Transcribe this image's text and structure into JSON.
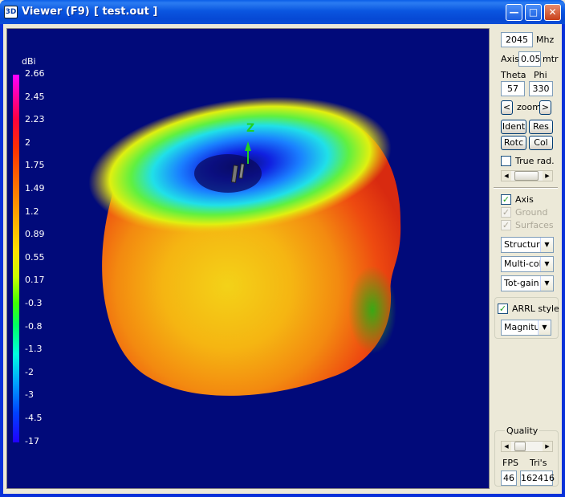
{
  "window": {
    "icon_text": "3D",
    "title": "Viewer (F9)",
    "file": "[  test.out ]",
    "min_glyph": "—",
    "max_glyph": "□",
    "close_glyph": "✕"
  },
  "legend": {
    "unit": "dBi",
    "labels": [
      "2.66",
      "2.45",
      "2.23",
      "2",
      "1.75",
      "1.49",
      "1.2",
      "0.89",
      "0.55",
      "0.17",
      "-0.3",
      "-0.8",
      "-1.3",
      "-2",
      "-3",
      "-4.5",
      "-17"
    ]
  },
  "scene": {
    "axis_label": "Z",
    "background": "#010a7a"
  },
  "controls": {
    "freq_value": "2045",
    "freq_unit": "Mhz",
    "axis_label": "Axis",
    "axis_value": "0.05",
    "axis_unit": "mtr",
    "theta_label": "Theta",
    "phi_label": "Phi",
    "theta_value": "57",
    "phi_value": "330",
    "zoom_left": "<",
    "zoom_label": "zoom",
    "zoom_right": ">",
    "ident_label": "Ident",
    "res_label": "Res",
    "rotc_label": "Rotc",
    "col_label": "Col",
    "true_rad_label": "True rad.",
    "axis_check_label": "Axis",
    "ground_check_label": "Ground",
    "surfaces_check_label": "Surfaces",
    "structure_value": "Structure",
    "color_value": "Multi-colo",
    "gain_value": "Tot-gain",
    "arrl_label": "ARRL style",
    "magnitude_value": "Magnitud",
    "quality_label": "Quality",
    "fps_label": "FPS",
    "tris_label": "Tri's",
    "fps_value": "46",
    "tris_value": "162416"
  },
  "checkboxes": {
    "true_rad": false,
    "axis": true,
    "ground": true,
    "surfaces": true,
    "arrl": true
  }
}
